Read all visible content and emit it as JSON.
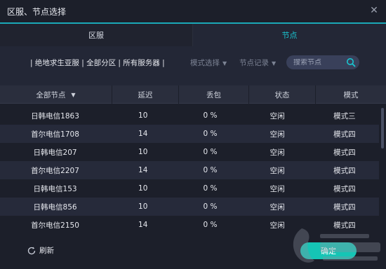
{
  "window": {
    "title": "区服、节点选择",
    "close_icon": "close-icon"
  },
  "tabs": [
    {
      "label": "区服",
      "active": false
    },
    {
      "label": "节点",
      "active": true
    }
  ],
  "filters": {
    "breadcrumb": "| 绝地求生亚服 | 全部分区 | 所有服务器 |",
    "mode_select": "模式选择",
    "node_history": "节点记录",
    "search_placeholder": "搜索节点"
  },
  "table": {
    "headers": [
      "全部节点",
      "延迟",
      "丢包",
      "状态",
      "模式"
    ],
    "rows": [
      {
        "node": "日韩电信1863",
        "latency": "10",
        "loss": "0 %",
        "status": "空闲",
        "mode": "模式三"
      },
      {
        "node": "首尔电信1708",
        "latency": "14",
        "loss": "0 %",
        "status": "空闲",
        "mode": "模式四"
      },
      {
        "node": "日韩电信207",
        "latency": "10",
        "loss": "0 %",
        "status": "空闲",
        "mode": "模式四"
      },
      {
        "node": "首尔电信2207",
        "latency": "14",
        "loss": "0 %",
        "status": "空闲",
        "mode": "模式四"
      },
      {
        "node": "日韩电信153",
        "latency": "10",
        "loss": "0 %",
        "status": "空闲",
        "mode": "模式四"
      },
      {
        "node": "日韩电信856",
        "latency": "10",
        "loss": "0 %",
        "status": "空闲",
        "mode": "模式四"
      },
      {
        "node": "首尔电信2150",
        "latency": "14",
        "loss": "0 %",
        "status": "空闲",
        "mode": "模式四"
      }
    ]
  },
  "footer": {
    "refresh_label": "刷新",
    "confirm_label": "确定"
  },
  "colors": {
    "accent": "#19c6d1",
    "confirm": "#15c5b5",
    "background": "#1c1f2a"
  }
}
